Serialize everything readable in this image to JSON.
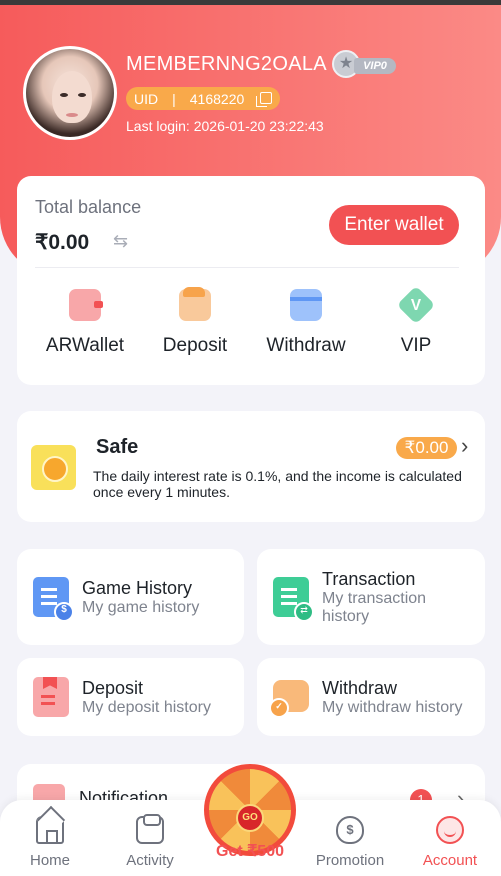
{
  "profile": {
    "username": "MEMBERNNG2OALA",
    "vip_level": "VIP0",
    "uid_label": "UID",
    "uid_sep": "|",
    "uid_value": "4168220",
    "last_login": "Last login: 2026-01-20 23:22:43"
  },
  "balance": {
    "label": "Total balance",
    "amount": "₹0.00",
    "enter_wallet": "Enter wallet",
    "items": [
      {
        "label": "ARWallet",
        "icon": "arwallet-icon"
      },
      {
        "label": "Deposit",
        "icon": "deposit-icon"
      },
      {
        "label": "Withdraw",
        "icon": "withdraw-icon"
      },
      {
        "label": "VIP",
        "icon": "vip-icon"
      }
    ]
  },
  "safe": {
    "title": "Safe",
    "amount": "₹0.00",
    "description": "The daily interest rate is 0.1%, and the income is calculated once every 1 minutes."
  },
  "history": [
    {
      "title": "Game History",
      "subtitle": "My game history"
    },
    {
      "title": "Transaction",
      "subtitle": "My transaction history"
    },
    {
      "title": "Deposit",
      "subtitle": "My deposit history"
    },
    {
      "title": "Withdraw",
      "subtitle": "My withdraw history"
    }
  ],
  "notification": {
    "label": "Notification",
    "count": "1"
  },
  "spin": {
    "go": "GO",
    "label": "Get ₹500"
  },
  "tabbar": {
    "items": [
      {
        "label": "Home"
      },
      {
        "label": "Activity"
      },
      {
        "label": "Promotion"
      },
      {
        "label": "Account"
      }
    ],
    "active": "Account"
  },
  "colors": {
    "accent": "#f25153",
    "orange": "#f9a94a",
    "header_start": "#f65b5b",
    "header_end": "#fb8a86"
  }
}
